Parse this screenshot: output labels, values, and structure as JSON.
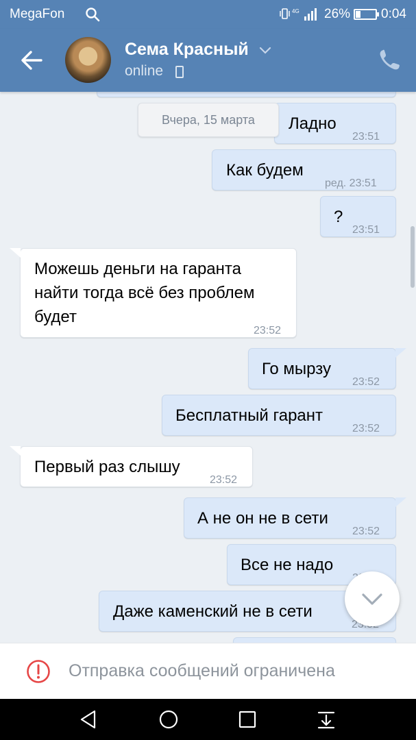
{
  "status_bar": {
    "carrier": "MegaFon",
    "network": "4G",
    "battery_percent": "26%",
    "battery_level": 0.26,
    "time": "0:04",
    "icons": [
      "search-icon",
      "vibrate-icon",
      "signal-icon",
      "battery-icon"
    ]
  },
  "header": {
    "contact_name": "Сема Красный",
    "status": "online",
    "icons": [
      "back-arrow-icon",
      "chevron-down-icon",
      "mobile-icon",
      "phone-icon"
    ]
  },
  "chat": {
    "date_separator": "Вчера, 15 марта",
    "messages": [
      {
        "direction": "out",
        "text": "Ладно",
        "time": "23:51"
      },
      {
        "direction": "out",
        "text": "Как будем",
        "time": "ред. 23:51"
      },
      {
        "direction": "out",
        "text": "?",
        "time": "23:51"
      },
      {
        "direction": "in",
        "text": "Можешь деньги на гаранта\nнайти тогда всё без проблем\nбудет",
        "time": "23:52"
      },
      {
        "direction": "out",
        "text": "Го мырзу",
        "time": "23:52"
      },
      {
        "direction": "out",
        "text": "Бесплатный гарант",
        "time": "23:52"
      },
      {
        "direction": "in",
        "text": "Первый раз слышу",
        "time": "23:52"
      },
      {
        "direction": "out",
        "text": "А не он не в сети",
        "time": "23:52"
      },
      {
        "direction": "out",
        "text": "Все не надо",
        "time": "23:52"
      },
      {
        "direction": "out",
        "text": "Даже каменский не в сети",
        "time": "23:52"
      }
    ]
  },
  "restriction": {
    "text": "Отправка сообщений ограничена",
    "icon": "warning-icon"
  },
  "navbar": {
    "icons": [
      "back-triangle-icon",
      "home-circle-icon",
      "recents-square-icon",
      "notifications-down-icon"
    ]
  },
  "colors": {
    "header_bg": "#5683b5",
    "chat_bg": "#ecf0f4",
    "outgoing_bubble": "#dbe8f9",
    "incoming_bubble": "#ffffff",
    "warning": "#e64646"
  }
}
